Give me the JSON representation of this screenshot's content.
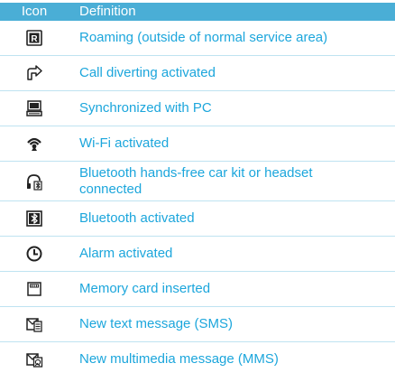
{
  "table": {
    "header": {
      "icon": "Icon",
      "definition": "Definition"
    },
    "header_color": "#4aaed6",
    "text_color": "#1ca6dc",
    "rows": [
      {
        "icon": "roaming-icon",
        "definition": "Roaming (outside of normal service area)"
      },
      {
        "icon": "call-divert-icon",
        "definition": "Call diverting activated"
      },
      {
        "icon": "pc-sync-icon",
        "definition": "Synchronized with PC"
      },
      {
        "icon": "wifi-icon",
        "definition": "Wi-Fi activated"
      },
      {
        "icon": "bt-headset-icon",
        "definition": "Bluetooth hands-free car kit or headset connected"
      },
      {
        "icon": "bluetooth-icon",
        "definition": "Bluetooth activated"
      },
      {
        "icon": "alarm-icon",
        "definition": "Alarm activated"
      },
      {
        "icon": "memory-card-icon",
        "definition": "Memory card inserted"
      },
      {
        "icon": "sms-icon",
        "definition": "New text message (SMS)"
      },
      {
        "icon": "mms-icon",
        "definition": "New multimedia message (MMS)"
      }
    ]
  }
}
